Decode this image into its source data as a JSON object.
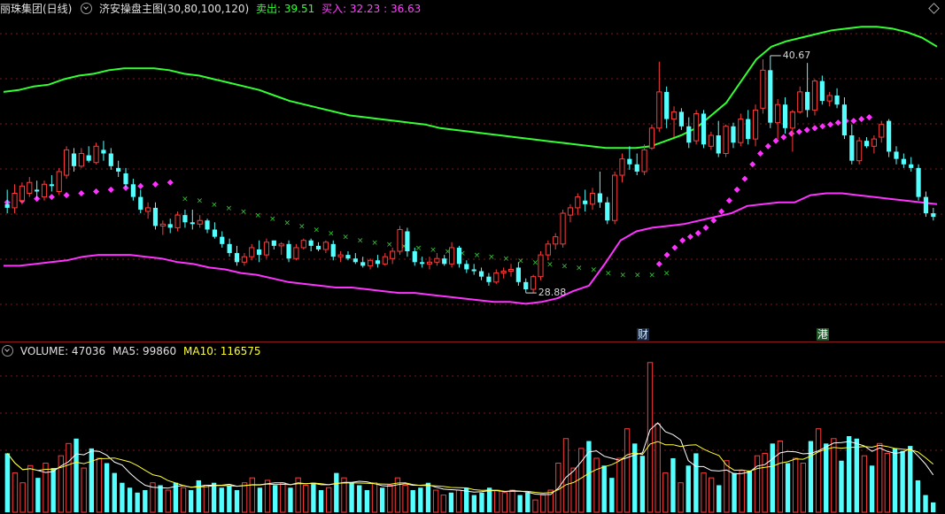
{
  "main_header": {
    "stock_name": "丽珠集团(日线)",
    "indicator_name": "济安操盘主图(30,80,100,120)",
    "sell_label": "卖出: 39.51",
    "buy_label": "买入: 32.23 : 36.63"
  },
  "volume_header": {
    "volume_label": "VOLUME: 47036",
    "ma5_label": "MA5: 99860",
    "ma10_label": "MA10: 116575"
  },
  "annotations": {
    "high_label": "40.67",
    "low_label": "28.88",
    "tag_cai": "财",
    "tag_gang": "港"
  },
  "colors": {
    "background": "#000000",
    "up_candle": "#ff3b3b",
    "down_candle": "#54ffff",
    "upper_band": "#33ff33",
    "lower_band": "#ff33ff",
    "buy_marker": "#ff33ff",
    "sell_marker": "#33cc33",
    "ma5": "#ffffff",
    "ma10": "#ffff33",
    "grid": "#7a1a1a",
    "sell_text": "#33ff33",
    "buy_text": "#ff44ff",
    "ma10_text": "#ffff33"
  },
  "icons": {
    "collapse_main": "chevron-down-icon",
    "collapse_volume": "chevron-down-icon",
    "panel_menu": "diamond-icon"
  },
  "chart_data": {
    "type": "candlestick",
    "price_range": [
      26,
      43
    ],
    "candles": [
      {
        "o": 32.8,
        "h": 33.6,
        "l": 32.3,
        "c": 32.6
      },
      {
        "o": 32.6,
        "h": 33.9,
        "l": 32.3,
        "c": 33.4
      },
      {
        "o": 33.0,
        "h": 34.0,
        "l": 32.8,
        "c": 33.8
      },
      {
        "o": 33.4,
        "h": 34.3,
        "l": 33.2,
        "c": 34.0
      },
      {
        "o": 33.6,
        "h": 34.1,
        "l": 33.1,
        "c": 33.5
      },
      {
        "o": 33.2,
        "h": 34.1,
        "l": 33.0,
        "c": 33.9
      },
      {
        "o": 33.9,
        "h": 34.4,
        "l": 33.5,
        "c": 33.8
      },
      {
        "o": 33.5,
        "h": 34.8,
        "l": 33.3,
        "c": 34.6
      },
      {
        "o": 34.4,
        "h": 36.0,
        "l": 34.2,
        "c": 35.8
      },
      {
        "o": 35.6,
        "h": 35.9,
        "l": 34.6,
        "c": 34.9
      },
      {
        "o": 34.9,
        "h": 35.9,
        "l": 34.8,
        "c": 35.6
      },
      {
        "o": 35.5,
        "h": 36.0,
        "l": 35.1,
        "c": 35.2
      },
      {
        "o": 35.1,
        "h": 36.2,
        "l": 35.0,
        "c": 36.0
      },
      {
        "o": 35.8,
        "h": 36.3,
        "l": 35.2,
        "c": 35.6
      },
      {
        "o": 35.6,
        "h": 35.9,
        "l": 34.7,
        "c": 34.9
      },
      {
        "o": 34.8,
        "h": 35.2,
        "l": 34.3,
        "c": 34.6
      },
      {
        "o": 34.5,
        "h": 34.8,
        "l": 33.7,
        "c": 33.9
      },
      {
        "o": 33.9,
        "h": 34.2,
        "l": 33.0,
        "c": 33.2
      },
      {
        "o": 33.2,
        "h": 33.6,
        "l": 32.3,
        "c": 32.5
      },
      {
        "o": 32.4,
        "h": 32.9,
        "l": 32.0,
        "c": 32.6
      },
      {
        "o": 32.6,
        "h": 32.9,
        "l": 31.4,
        "c": 31.6
      },
      {
        "o": 31.6,
        "h": 31.9,
        "l": 31.1,
        "c": 31.7
      },
      {
        "o": 31.7,
        "h": 32.0,
        "l": 31.2,
        "c": 31.5
      },
      {
        "o": 31.5,
        "h": 32.4,
        "l": 31.3,
        "c": 32.2
      },
      {
        "o": 32.2,
        "h": 32.5,
        "l": 31.5,
        "c": 31.8
      },
      {
        "o": 31.8,
        "h": 32.5,
        "l": 31.4,
        "c": 31.7
      },
      {
        "o": 31.7,
        "h": 32.2,
        "l": 31.5,
        "c": 31.9
      },
      {
        "o": 31.9,
        "h": 32.0,
        "l": 31.2,
        "c": 31.4
      },
      {
        "o": 31.4,
        "h": 31.8,
        "l": 30.9,
        "c": 31.0
      },
      {
        "o": 31.0,
        "h": 31.3,
        "l": 30.4,
        "c": 30.6
      },
      {
        "o": 30.6,
        "h": 30.9,
        "l": 29.9,
        "c": 30.1
      },
      {
        "o": 30.1,
        "h": 30.5,
        "l": 29.4,
        "c": 29.6
      },
      {
        "o": 29.6,
        "h": 30.1,
        "l": 29.4,
        "c": 29.9
      },
      {
        "o": 29.9,
        "h": 30.6,
        "l": 29.7,
        "c": 30.4
      },
      {
        "o": 30.3,
        "h": 30.8,
        "l": 29.6,
        "c": 30.0
      },
      {
        "o": 30.0,
        "h": 30.9,
        "l": 29.8,
        "c": 30.7
      },
      {
        "o": 30.8,
        "h": 30.7,
        "l": 30.3,
        "c": 30.5
      },
      {
        "o": 30.5,
        "h": 30.7,
        "l": 30.0,
        "c": 30.6
      },
      {
        "o": 30.6,
        "h": 30.8,
        "l": 29.6,
        "c": 29.8
      },
      {
        "o": 29.8,
        "h": 30.6,
        "l": 29.7,
        "c": 30.4
      },
      {
        "o": 30.4,
        "h": 30.9,
        "l": 30.3,
        "c": 30.8
      },
      {
        "o": 30.8,
        "h": 30.9,
        "l": 30.2,
        "c": 30.5
      },
      {
        "o": 30.5,
        "h": 30.7,
        "l": 30.2,
        "c": 30.3
      },
      {
        "o": 30.3,
        "h": 30.8,
        "l": 30.1,
        "c": 30.7
      },
      {
        "o": 30.6,
        "h": 30.8,
        "l": 29.7,
        "c": 29.9
      },
      {
        "o": 29.9,
        "h": 30.2,
        "l": 29.6,
        "c": 30.0
      },
      {
        "o": 30.0,
        "h": 30.2,
        "l": 29.7,
        "c": 29.8
      },
      {
        "o": 29.8,
        "h": 30.1,
        "l": 29.5,
        "c": 29.6
      },
      {
        "o": 29.6,
        "h": 29.9,
        "l": 29.3,
        "c": 29.4
      },
      {
        "o": 29.4,
        "h": 29.8,
        "l": 29.2,
        "c": 29.7
      },
      {
        "o": 29.7,
        "h": 30.0,
        "l": 29.3,
        "c": 29.5
      },
      {
        "o": 29.5,
        "h": 30.1,
        "l": 29.4,
        "c": 29.9
      },
      {
        "o": 29.8,
        "h": 30.4,
        "l": 29.5,
        "c": 30.2
      },
      {
        "o": 30.2,
        "h": 31.6,
        "l": 30.0,
        "c": 31.4
      },
      {
        "o": 31.3,
        "h": 31.5,
        "l": 29.9,
        "c": 30.2
      },
      {
        "o": 30.2,
        "h": 30.4,
        "l": 29.4,
        "c": 29.6
      },
      {
        "o": 29.6,
        "h": 29.9,
        "l": 29.3,
        "c": 29.5
      },
      {
        "o": 29.5,
        "h": 29.9,
        "l": 29.2,
        "c": 29.6
      },
      {
        "o": 29.6,
        "h": 30.1,
        "l": 29.4,
        "c": 29.8
      },
      {
        "o": 29.8,
        "h": 30.0,
        "l": 29.4,
        "c": 29.5
      },
      {
        "o": 29.5,
        "h": 30.7,
        "l": 29.3,
        "c": 30.4
      },
      {
        "o": 30.4,
        "h": 30.5,
        "l": 29.3,
        "c": 29.5
      },
      {
        "o": 29.5,
        "h": 29.7,
        "l": 29.0,
        "c": 29.2
      },
      {
        "o": 29.2,
        "h": 29.5,
        "l": 28.9,
        "c": 29.1
      },
      {
        "o": 29.1,
        "h": 29.3,
        "l": 28.6,
        "c": 28.8
      },
      {
        "o": 28.8,
        "h": 29.0,
        "l": 28.3,
        "c": 28.5
      },
      {
        "o": 28.5,
        "h": 29.2,
        "l": 28.4,
        "c": 29.0
      },
      {
        "o": 29.0,
        "h": 29.3,
        "l": 28.7,
        "c": 29.1
      },
      {
        "o": 29.1,
        "h": 29.5,
        "l": 28.8,
        "c": 29.2
      },
      {
        "o": 29.3,
        "h": 29.6,
        "l": 28.3,
        "c": 28.5
      },
      {
        "o": 28.5,
        "h": 28.7,
        "l": 27.9,
        "c": 28.1
      },
      {
        "o": 28.1,
        "h": 28.9,
        "l": 27.9,
        "c": 28.8
      },
      {
        "o": 28.8,
        "h": 30.2,
        "l": 28.6,
        "c": 30.0
      },
      {
        "o": 30.0,
        "h": 30.8,
        "l": 29.7,
        "c": 30.6
      },
      {
        "o": 30.6,
        "h": 31.2,
        "l": 30.3,
        "c": 31.0
      },
      {
        "o": 30.6,
        "h": 32.5,
        "l": 30.4,
        "c": 32.3
      },
      {
        "o": 32.2,
        "h": 32.8,
        "l": 31.8,
        "c": 32.6
      },
      {
        "o": 32.6,
        "h": 33.4,
        "l": 32.2,
        "c": 33.2
      },
      {
        "o": 33.0,
        "h": 33.6,
        "l": 32.4,
        "c": 32.8
      },
      {
        "o": 32.8,
        "h": 33.7,
        "l": 32.5,
        "c": 33.4
      },
      {
        "o": 33.4,
        "h": 34.6,
        "l": 32.6,
        "c": 32.9
      },
      {
        "o": 32.9,
        "h": 33.2,
        "l": 31.7,
        "c": 31.9
      },
      {
        "o": 31.9,
        "h": 34.6,
        "l": 31.7,
        "c": 34.4
      },
      {
        "o": 34.4,
        "h": 35.6,
        "l": 34.0,
        "c": 35.3
      },
      {
        "o": 35.3,
        "h": 36.0,
        "l": 34.7,
        "c": 35.0
      },
      {
        "o": 35.0,
        "h": 35.6,
        "l": 34.4,
        "c": 34.6
      },
      {
        "o": 34.6,
        "h": 36.1,
        "l": 34.4,
        "c": 35.8
      },
      {
        "o": 35.9,
        "h": 37.2,
        "l": 35.8,
        "c": 37.0
      },
      {
        "o": 37.0,
        "h": 40.67,
        "l": 36.8,
        "c": 39.0
      },
      {
        "o": 39.0,
        "h": 39.3,
        "l": 37.0,
        "c": 37.5
      },
      {
        "o": 37.5,
        "h": 38.2,
        "l": 36.5,
        "c": 37.9
      },
      {
        "o": 37.9,
        "h": 38.1,
        "l": 36.9,
        "c": 37.1
      },
      {
        "o": 37.1,
        "h": 37.6,
        "l": 35.9,
        "c": 36.2
      },
      {
        "o": 36.3,
        "h": 38.0,
        "l": 36.1,
        "c": 37.8
      },
      {
        "o": 37.8,
        "h": 38.0,
        "l": 35.9,
        "c": 36.1
      },
      {
        "o": 36.0,
        "h": 36.8,
        "l": 35.8,
        "c": 36.6
      },
      {
        "o": 36.6,
        "h": 37.4,
        "l": 35.4,
        "c": 35.6
      },
      {
        "o": 35.6,
        "h": 37.2,
        "l": 35.4,
        "c": 37.1
      },
      {
        "o": 37.1,
        "h": 37.3,
        "l": 35.9,
        "c": 36.2
      },
      {
        "o": 36.2,
        "h": 37.8,
        "l": 36.0,
        "c": 37.5
      },
      {
        "o": 37.5,
        "h": 38.0,
        "l": 36.1,
        "c": 36.4
      },
      {
        "o": 36.4,
        "h": 38.3,
        "l": 36.0,
        "c": 38.0
      },
      {
        "o": 38.1,
        "h": 40.8,
        "l": 37.8,
        "c": 40.2
      },
      {
        "o": 40.2,
        "h": 41.0,
        "l": 37.0,
        "c": 37.3
      },
      {
        "o": 37.3,
        "h": 38.6,
        "l": 36.4,
        "c": 38.3
      },
      {
        "o": 38.3,
        "h": 38.7,
        "l": 36.7,
        "c": 37.0
      },
      {
        "o": 37.0,
        "h": 38.0,
        "l": 35.7,
        "c": 37.9
      },
      {
        "o": 37.9,
        "h": 39.3,
        "l": 37.8,
        "c": 39.0
      },
      {
        "o": 39.0,
        "h": 40.6,
        "l": 37.6,
        "c": 38.0
      },
      {
        "o": 38.0,
        "h": 39.7,
        "l": 37.7,
        "c": 39.6
      },
      {
        "o": 39.6,
        "h": 39.9,
        "l": 38.3,
        "c": 38.5
      },
      {
        "o": 38.5,
        "h": 39.0,
        "l": 38.2,
        "c": 38.8
      },
      {
        "o": 38.8,
        "h": 39.2,
        "l": 38.1,
        "c": 38.3
      },
      {
        "o": 38.3,
        "h": 38.7,
        "l": 36.4,
        "c": 36.6
      },
      {
        "o": 36.6,
        "h": 37.2,
        "l": 35.0,
        "c": 35.2
      },
      {
        "o": 35.2,
        "h": 36.5,
        "l": 35.0,
        "c": 36.3
      },
      {
        "o": 36.3,
        "h": 36.5,
        "l": 35.9,
        "c": 36.0
      },
      {
        "o": 36.0,
        "h": 36.6,
        "l": 35.6,
        "c": 36.4
      },
      {
        "o": 36.5,
        "h": 37.4,
        "l": 36.2,
        "c": 37.2
      },
      {
        "o": 37.4,
        "h": 37.5,
        "l": 35.4,
        "c": 35.7
      },
      {
        "o": 35.7,
        "h": 36.0,
        "l": 35.0,
        "c": 35.3
      },
      {
        "o": 35.3,
        "h": 35.6,
        "l": 34.8,
        "c": 35.0
      },
      {
        "o": 35.0,
        "h": 35.4,
        "l": 34.6,
        "c": 34.8
      },
      {
        "o": 34.8,
        "h": 35.0,
        "l": 33.0,
        "c": 33.2
      },
      {
        "o": 33.2,
        "h": 33.5,
        "l": 32.1,
        "c": 32.3
      },
      {
        "o": 32.3,
        "h": 32.6,
        "l": 31.9,
        "c": 32.1
      }
    ],
    "upper_band": [
      39.0,
      39.1,
      39.3,
      39.4,
      39.7,
      39.9,
      40.0,
      40.2,
      40.3,
      40.3,
      40.3,
      40.2,
      40.0,
      39.9,
      39.7,
      39.5,
      39.3,
      39.1,
      38.8,
      38.5,
      38.3,
      38.1,
      37.9,
      37.7,
      37.6,
      37.5,
      37.4,
      37.3,
      37.2,
      37.0,
      36.9,
      36.8,
      36.7,
      36.6,
      36.5,
      36.4,
      36.3,
      36.2,
      36.1,
      36.0,
      35.9,
      35.9,
      35.9,
      36.0,
      36.3,
      36.6,
      37.0,
      37.7,
      38.4,
      39.6,
      40.8,
      41.5,
      41.8,
      42.0,
      42.2,
      42.4,
      42.5,
      42.6,
      42.6,
      42.5,
      42.3,
      42.0,
      41.5
    ],
    "lower_band": [
      29.4,
      29.4,
      29.5,
      29.6,
      29.7,
      29.9,
      30.0,
      30.0,
      30.0,
      29.9,
      29.8,
      29.6,
      29.5,
      29.3,
      29.2,
      29.0,
      28.9,
      28.7,
      28.5,
      28.4,
      28.3,
      28.2,
      28.2,
      28.1,
      28.0,
      27.9,
      27.9,
      27.8,
      27.7,
      27.6,
      27.5,
      27.4,
      27.4,
      27.3,
      27.4,
      27.6,
      28.0,
      28.3,
      29.5,
      30.8,
      31.3,
      31.5,
      31.6,
      31.7,
      31.9,
      32.1,
      32.3,
      32.7,
      32.8,
      32.9,
      32.9,
      33.3,
      33.4,
      33.4,
      33.3,
      33.2,
      33.1,
      33.0,
      32.9,
      32.8
    ],
    "sell_line": [
      33.1,
      33.0,
      32.8,
      32.6,
      32.4,
      32.2,
      32.0,
      31.8,
      31.6,
      31.4,
      31.2,
      31.0,
      30.8,
      30.7,
      30.6,
      30.5,
      30.4,
      30.3,
      30.2,
      30.1,
      30.0,
      29.9,
      29.8,
      29.7,
      29.6,
      29.5,
      29.4,
      29.3,
      29.2,
      29.0,
      28.9,
      28.9,
      28.9,
      29.0
    ],
    "buy_line": [
      32.9,
      33.0,
      33.1,
      33.2,
      33.3,
      33.4,
      33.5,
      33.6,
      33.7,
      33.8,
      33.9,
      34.0,
      29.5,
      30.0,
      30.4,
      30.8,
      31.0,
      31.2,
      31.5,
      31.9,
      32.4,
      33.0,
      33.6,
      34.2,
      35.0,
      35.6,
      36.0,
      36.3,
      36.5,
      36.7,
      36.8,
      36.9,
      37.0,
      37.1,
      37.2,
      37.3,
      37.4,
      37.4,
      37.5,
      37.6
    ],
    "volume": {
      "range": [
        0,
        310000
      ],
      "values": [
        120,
        80,
        60,
        95,
        70,
        100,
        90,
        115,
        140,
        150,
        90,
        130,
        110,
        100,
        80,
        60,
        50,
        40,
        45,
        60,
        55,
        45,
        60,
        50,
        45,
        65,
        55,
        60,
        50,
        55,
        45,
        60,
        70,
        50,
        65,
        55,
        60,
        50,
        70,
        55,
        60,
        45,
        50,
        80,
        70,
        60,
        55,
        45,
        60,
        50,
        55,
        70,
        55,
        45,
        50,
        60,
        45,
        35,
        40,
        45,
        50,
        35,
        40,
        50,
        45,
        40,
        45,
        35,
        40,
        25,
        35,
        45,
        100,
        150,
        90,
        130,
        145,
        110,
        95,
        70,
        110,
        170,
        140,
        115,
        305,
        180,
        80,
        110,
        60,
        95,
        120,
        80,
        70,
        55,
        105,
        80,
        85,
        85,
        115,
        120,
        140,
        145,
        100,
        110,
        100,
        145,
        170,
        140,
        150,
        105,
        155,
        150,
        115,
        95,
        140,
        120,
        130,
        125,
        135,
        65,
        35,
        20
      ],
      "ma5_label": "MA5",
      "ma10_label": "MA10"
    }
  }
}
